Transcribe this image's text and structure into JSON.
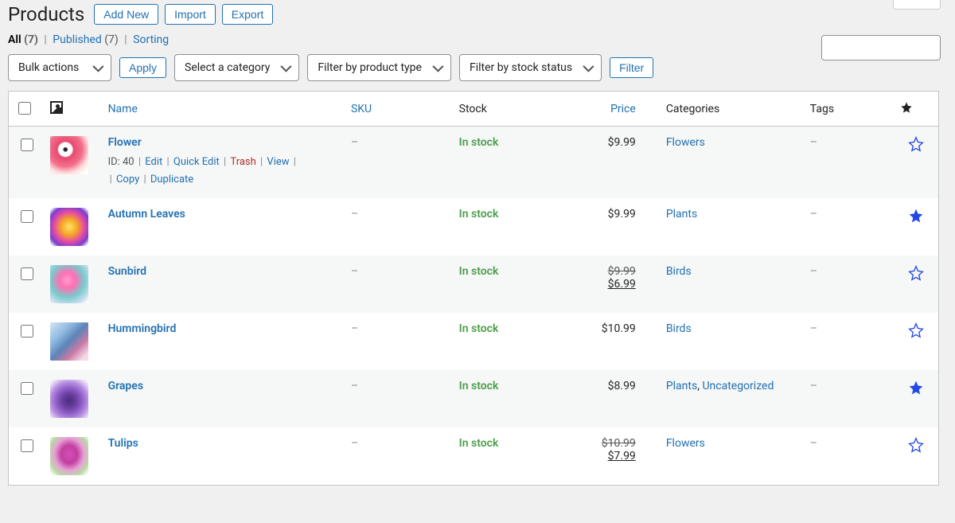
{
  "colors": {
    "link": "#2271b1",
    "danger": "#b32d2e",
    "instock": "#4a9d4a",
    "star": "#2249e6"
  },
  "header": {
    "title": "Products",
    "add_new": "Add New",
    "import": "Import",
    "export": "Export"
  },
  "views": {
    "all_label": "All",
    "all_count": "(7)",
    "published_label": "Published",
    "published_count": "(7)",
    "sorting": "Sorting"
  },
  "filters": {
    "bulk": "Bulk actions",
    "apply": "Apply",
    "category": "Select a category",
    "type": "Filter by product type",
    "stock": "Filter by stock status",
    "filter_btn": "Filter"
  },
  "columns": {
    "name": "Name",
    "sku": "SKU",
    "stock": "Stock",
    "price": "Price",
    "categories": "Categories",
    "tags": "Tags"
  },
  "row_actions": {
    "id_prefix": "ID: ",
    "edit": "Edit",
    "quick_edit": "Quick Edit",
    "trash": "Trash",
    "view": "View",
    "copy": "Copy",
    "duplicate": "Duplicate"
  },
  "products": [
    {
      "name": "Flower",
      "id": "40",
      "sku": "–",
      "stock": "In stock",
      "price": "$9.99",
      "sale_price": null,
      "categories": [
        "Flowers"
      ],
      "tags": "–",
      "featured": false,
      "show_actions": true,
      "thumb_gradient": "radial-gradient(circle at 40% 35%, #2a2a2a 0%, #2a2a2a 6%, #fff 7%, #fff 20%, #e84a6f 24%, #f16f8a 50%, #fdd 70%, #fff 90%)"
    },
    {
      "name": "Autumn Leaves",
      "id": "",
      "sku": "–",
      "stock": "In stock",
      "price": "$9.99",
      "sale_price": null,
      "categories": [
        "Plants"
      ],
      "tags": "–",
      "featured": true,
      "show_actions": false,
      "thumb_gradient": "radial-gradient(circle at 50% 50%, #ffe36b 0%, #f5a623 30%, #e64ca3 55%, #7a3fcf 78%, #fff 95%)"
    },
    {
      "name": "Sunbird",
      "id": "",
      "sku": "–",
      "stock": "In stock",
      "price": "$9.99",
      "sale_price": "$6.99",
      "categories": [
        "Birds"
      ],
      "tags": "–",
      "featured": false,
      "show_actions": false,
      "thumb_gradient": "radial-gradient(circle at 45% 40%, #ff9ccf 0%, #ff6fb5 25%, #7cc 55%, #cde 80%, #fff 95%)"
    },
    {
      "name": "Hummingbird",
      "id": "",
      "sku": "–",
      "stock": "In stock",
      "price": "$10.99",
      "sale_price": null,
      "categories": [
        "Birds"
      ],
      "tags": "–",
      "featured": false,
      "show_actions": false,
      "thumb_gradient": "linear-gradient(135deg, #d6e6f5 0%, #8fb8e0 30%, #5c84b8 50%, #c97aa5 70%, #f5d9e6 90%)"
    },
    {
      "name": "Grapes",
      "id": "",
      "sku": "–",
      "stock": "In stock",
      "price": "$8.99",
      "sale_price": null,
      "categories": [
        "Plants",
        "Uncategorized"
      ],
      "tags": "–",
      "featured": true,
      "show_actions": false,
      "thumb_gradient": "radial-gradient(circle at 50% 55%, #4a2d7a 0%, #6b3fa0 25%, #8e5ec7 45%, #b68ee0 65%, #e8d9f5 85%, #fff 100%)"
    },
    {
      "name": "Tulips",
      "id": "",
      "sku": "–",
      "stock": "In stock",
      "price": "$10.99",
      "sale_price": "$7.99",
      "categories": [
        "Flowers"
      ],
      "tags": "–",
      "featured": false,
      "show_actions": false,
      "thumb_gradient": "radial-gradient(ellipse at 50% 45%, #d64fb5 0%, #c23fa0 30%, #e6a3d6 55%, #b8d9a3 75%, #fff 95%)"
    }
  ]
}
